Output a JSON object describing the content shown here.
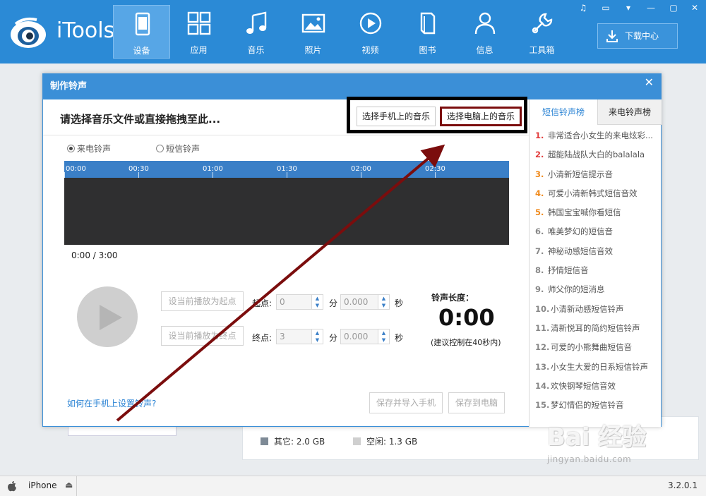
{
  "app": {
    "name": "iTools",
    "version": "3.2.0.1",
    "device_name": "iPhone",
    "accent_color": "#2b8ad6",
    "highlight_color": "#7b0d0d"
  },
  "nav": [
    {
      "label": "设备",
      "icon": "device-icon",
      "active": true
    },
    {
      "label": "应用",
      "icon": "apps-icon",
      "active": false
    },
    {
      "label": "音乐",
      "icon": "music-icon",
      "active": false
    },
    {
      "label": "照片",
      "icon": "photo-icon",
      "active": false
    },
    {
      "label": "视频",
      "icon": "video-icon",
      "active": false
    },
    {
      "label": "图书",
      "icon": "book-icon",
      "active": false
    },
    {
      "label": "信息",
      "icon": "user-icon",
      "active": false
    },
    {
      "label": "工具箱",
      "icon": "toolbox-icon",
      "active": false
    }
  ],
  "download_center": "下载中心",
  "background": {
    "legend": [
      {
        "label": "其它: 2.0 GB",
        "color": "#7e8a96"
      },
      {
        "label": "空闲: 1.3 GB",
        "color": "#cfcfcf"
      }
    ]
  },
  "dialog": {
    "title": "制作铃声",
    "close": "✕",
    "heading": "请选择音乐文件或直接拖拽至此...",
    "pick_phone": "选择手机上的音乐",
    "pick_pc": "选择电脑上的音乐",
    "radio_call": "来电铃声",
    "radio_sms": "短信铃声",
    "timeline_ticks": [
      "00:00",
      "00:30",
      "01:00",
      "01:30",
      "02:00",
      "02:30"
    ],
    "time_readout": "0:00 / 3:00",
    "set_start": "设当前播放为起点",
    "set_end": "设当前播放为终点",
    "start_label": "起点:",
    "end_label": "终点:",
    "min_unit": "分",
    "sec_unit": "秒",
    "start_min": "0",
    "start_sec": "0.000",
    "end_min": "3",
    "end_sec": "0.000",
    "length_label": "铃声长度：",
    "length_value": "0:00",
    "length_hint": "(建议控制在40秒内)",
    "help_link": "如何在手机上设置铃声?",
    "save_import": "保存并导入手机",
    "save_pc": "保存到电脑"
  },
  "ranking": {
    "tab_sms": "短信铃声榜",
    "tab_call": "来电铃声榜",
    "items": [
      {
        "num": "1.",
        "title": "非常适合小女生的来电炫彩...",
        "color": "#e23b3b"
      },
      {
        "num": "2.",
        "title": "超能陆战队大白的balalala",
        "color": "#e23b3b"
      },
      {
        "num": "3.",
        "title": "小清新短信提示音",
        "color": "#f08a1c"
      },
      {
        "num": "4.",
        "title": "可爱小清新韩式短信音效",
        "color": "#f08a1c"
      },
      {
        "num": "5.",
        "title": "韩国宝宝喊你看短信",
        "color": "#f08a1c"
      },
      {
        "num": "6.",
        "title": "唯美梦幻的短信音",
        "color": "#888888"
      },
      {
        "num": "7.",
        "title": "神秘动感短信音效",
        "color": "#888888"
      },
      {
        "num": "8.",
        "title": "抒情短信音",
        "color": "#888888"
      },
      {
        "num": "9.",
        "title": "师父你的短消息",
        "color": "#888888"
      },
      {
        "num": "10.",
        "title": "小清新动感短信铃声",
        "color": "#888888"
      },
      {
        "num": "11.",
        "title": "清新悦耳的简约短信铃声",
        "color": "#888888"
      },
      {
        "num": "12.",
        "title": "可爱的小熊舞曲短信音",
        "color": "#888888"
      },
      {
        "num": "13.",
        "title": "小女生大爱的日系短信铃声",
        "color": "#888888"
      },
      {
        "num": "14.",
        "title": "欢快钢琴短信音效",
        "color": "#888888"
      },
      {
        "num": "15.",
        "title": "梦幻情侣的短信铃音",
        "color": "#888888"
      }
    ]
  },
  "watermark": {
    "brand": "Bai 经验",
    "url": "jingyan.baidu.com"
  }
}
